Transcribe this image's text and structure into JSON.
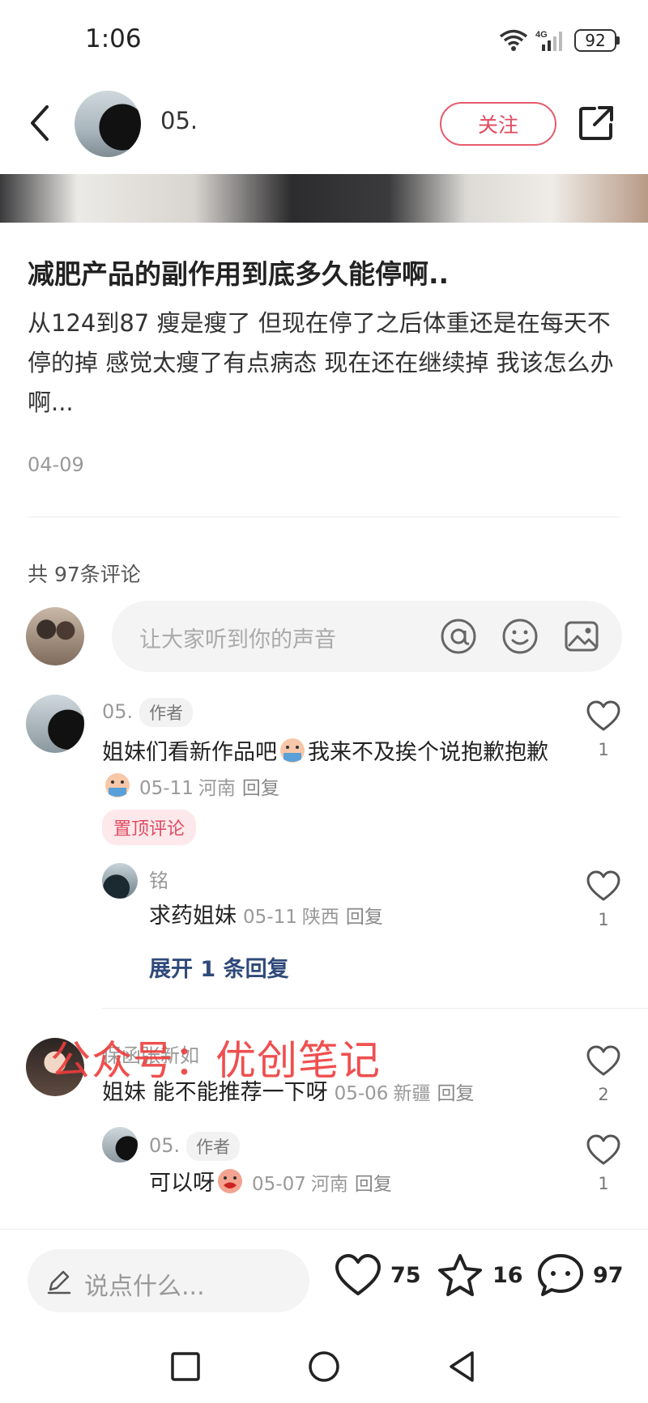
{
  "status_bar": {
    "time": "1:06",
    "network": "4G",
    "battery": "92"
  },
  "header": {
    "author_name": "05.",
    "follow_label": "关注"
  },
  "post": {
    "title": "减肥产品的副作用到底多久能停啊..",
    "body": "从124到87 瘦是瘦了 但现在停了之后体重还是在每天不停的掉 感觉太瘦了有点病态 现在还在继续掉 我该怎么办啊...",
    "date": "04-09"
  },
  "comments_section": {
    "count_label": "共 97条评论",
    "input_placeholder": "让大家听到你的声音"
  },
  "comments": [
    {
      "name": "05.",
      "tag": "作者",
      "text_a": "姐妹们看新作品吧",
      "text_b": "我来不及挨个说抱歉抱歉",
      "date": "05-11",
      "location": "河南",
      "reply": "回复",
      "pinned_label": "置顶评论",
      "likes": "1",
      "sub_reply": {
        "name": "铭",
        "text": "求药姐妹",
        "date": "05-11",
        "location": "陕西",
        "reply": "回复",
        "likes": "1"
      },
      "expand_label": "展开 1 条回复"
    },
    {
      "name": "保函张新如",
      "text": "姐妹 能不能推荐一下呀",
      "date": "05-06",
      "location": "新疆",
      "reply": "回复",
      "likes": "2",
      "sub_reply": {
        "name": "05.",
        "tag": "作者",
        "text": "可以呀",
        "date": "05-07",
        "location": "河南",
        "reply": "回复",
        "likes": "1"
      }
    }
  ],
  "watermark": "公众号：优创笔记",
  "bottom_bar": {
    "input_placeholder": "说点什么...",
    "likes": "75",
    "favorites": "16",
    "comments": "97"
  },
  "icons": [
    "back-icon",
    "share-icon",
    "at-icon",
    "smile-icon",
    "image-icon",
    "heart-icon",
    "star-icon",
    "chat-icon",
    "pencil-icon",
    "wifi-icon",
    "signal-icon"
  ],
  "colors": {
    "accent": "#e24a5e",
    "expand_link": "#2f4a7a",
    "watermark": "#ee3c3c"
  }
}
